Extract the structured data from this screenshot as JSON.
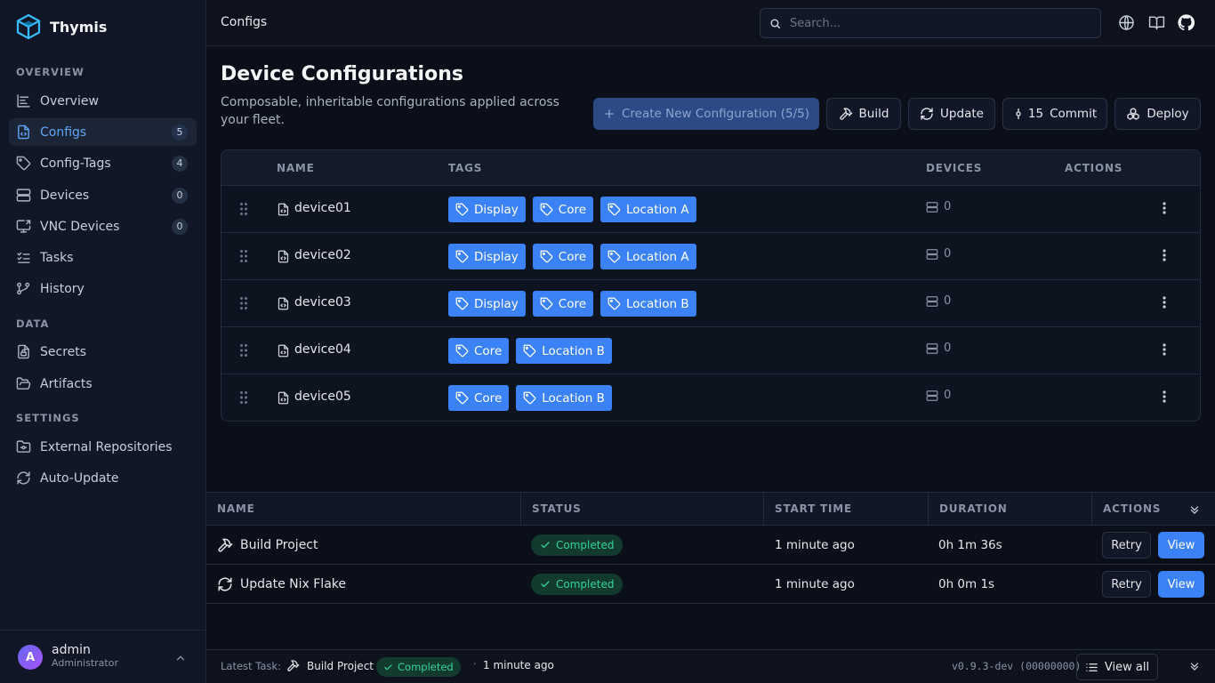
{
  "app": {
    "name": "Thymis"
  },
  "sidebar": {
    "sections": {
      "overview": "OVERVIEW",
      "data": "DATA",
      "settings": "SETTINGS"
    },
    "items": [
      {
        "label": "Overview",
        "icon": "chart-icon"
      },
      {
        "label": "Configs",
        "icon": "file-code-icon",
        "count": "5",
        "active": true
      },
      {
        "label": "Config-Tags",
        "icon": "tag-icon",
        "count": "4"
      },
      {
        "label": "Devices",
        "icon": "server-icon",
        "count": "0"
      },
      {
        "label": "VNC Devices",
        "icon": "screen-share-icon",
        "count": "0"
      },
      {
        "label": "Tasks",
        "icon": "list-checks-icon"
      },
      {
        "label": "History",
        "icon": "git-history-icon"
      },
      {
        "label": "Secrets",
        "icon": "file-lock-icon"
      },
      {
        "label": "Artifacts",
        "icon": "folder-open-icon"
      },
      {
        "label": "External Repositories",
        "icon": "folder-git-icon"
      },
      {
        "label": "Auto-Update",
        "icon": "refresh-icon"
      }
    ],
    "user": {
      "initial": "A",
      "name": "admin",
      "role": "Administrator"
    }
  },
  "topbar": {
    "breadcrumb": "Configs",
    "search_placeholder": "Search..."
  },
  "page": {
    "title": "Device Configurations",
    "subtitle": "Composable, inheritable configurations applied across your fleet."
  },
  "actions": {
    "create": "Create New Configuration (5/5)",
    "build": "Build",
    "update": "Update",
    "commit_count": "15",
    "commit": "Commit",
    "deploy": "Deploy"
  },
  "config_table": {
    "headers": {
      "name": "NAME",
      "tags": "TAGS",
      "devices": "DEVICES",
      "actions": "ACTIONS"
    },
    "rows": [
      {
        "name": "device01",
        "tags": [
          "Display",
          "Core",
          "Location A"
        ],
        "devices": "0"
      },
      {
        "name": "device02",
        "tags": [
          "Display",
          "Core",
          "Location A"
        ],
        "devices": "0"
      },
      {
        "name": "device03",
        "tags": [
          "Display",
          "Core",
          "Location B"
        ],
        "devices": "0"
      },
      {
        "name": "device04",
        "tags": [
          "Core",
          "Location B"
        ],
        "devices": "0"
      },
      {
        "name": "device05",
        "tags": [
          "Core",
          "Location B"
        ],
        "devices": "0"
      }
    ]
  },
  "tasks_table": {
    "headers": {
      "name": "NAME",
      "status": "STATUS",
      "start": "START TIME",
      "duration": "DURATION",
      "actions": "ACTIONS"
    },
    "rows": [
      {
        "name": "Build Project",
        "icon": "hammer-icon",
        "status": "Completed",
        "start": "1 minute ago",
        "duration": "0h 1m 36s",
        "retry": "Retry",
        "view": "View"
      },
      {
        "name": "Update Nix Flake",
        "icon": "refresh-icon",
        "status": "Completed",
        "start": "1 minute ago",
        "duration": "0h 0m 1s",
        "retry": "Retry",
        "view": "View"
      }
    ]
  },
  "footer": {
    "latest_label": "Latest Task:",
    "latest_task": "Build Project",
    "latest_status": "Completed",
    "separator": "·",
    "latest_time": "1 minute ago",
    "version": "v0.9.3-dev (00000000)",
    "view_all": "View all"
  }
}
